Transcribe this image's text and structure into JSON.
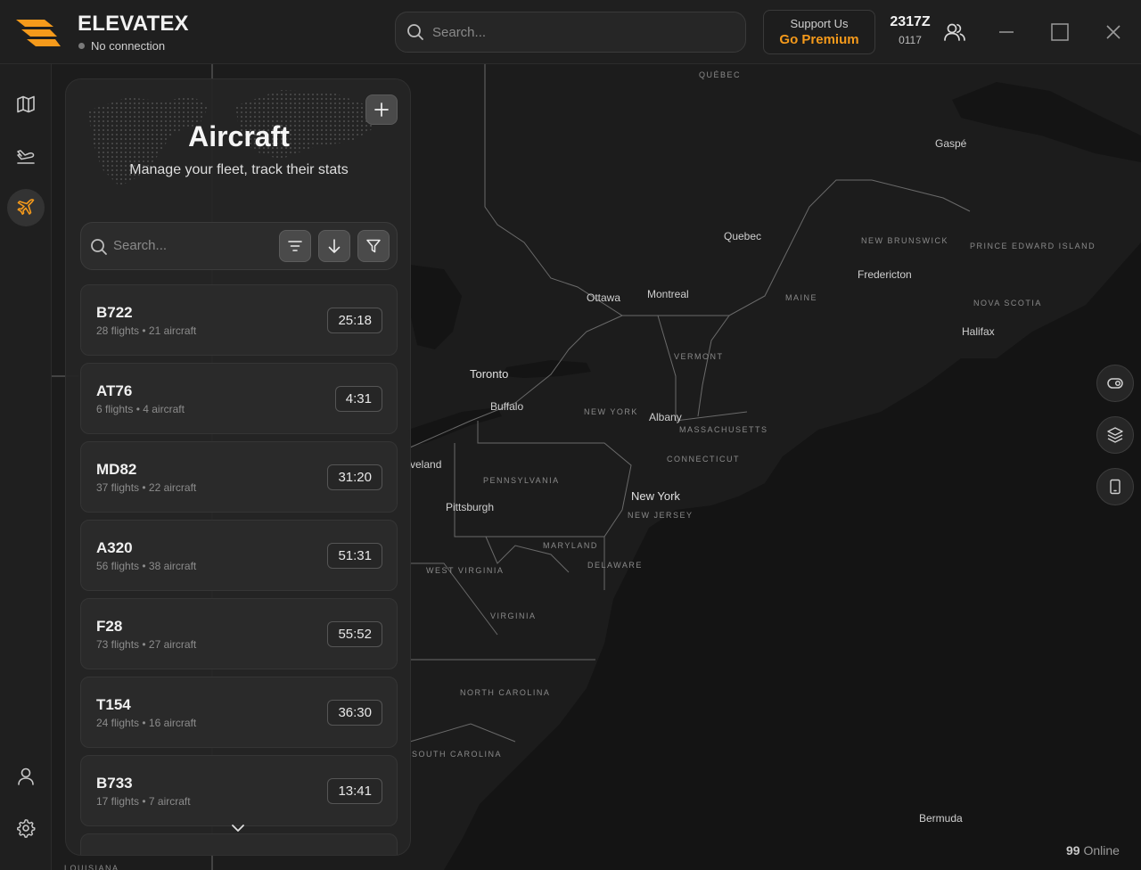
{
  "app": {
    "name": "ELEVATEX",
    "connection_status": "No connection",
    "search_placeholder": "Search...",
    "support_label": "Support Us",
    "premium_label": "Go Premium",
    "zulu_time": "2317Z",
    "local_time": "0117",
    "accent_color": "#f59a1b"
  },
  "rail": {
    "items": [
      {
        "name": "map-icon"
      },
      {
        "name": "flights-icon"
      },
      {
        "name": "aircraft-icon",
        "active": true
      },
      {
        "name": "profile-icon"
      },
      {
        "name": "settings-icon"
      }
    ]
  },
  "panel": {
    "title": "Aircraft",
    "subtitle": "Manage your fleet, track their stats",
    "search_placeholder": "Search...",
    "aircraft": [
      {
        "code": "B722",
        "meta": "28 flights • 21 aircraft",
        "time": "25:18"
      },
      {
        "code": "AT76",
        "meta": "6 flights • 4 aircraft",
        "time": "4:31"
      },
      {
        "code": "MD82",
        "meta": "37 flights • 22 aircraft",
        "time": "31:20"
      },
      {
        "code": "A320",
        "meta": "56 flights • 38 aircraft",
        "time": "51:31"
      },
      {
        "code": "F28",
        "meta": "73 flights • 27 aircraft",
        "time": "55:52"
      },
      {
        "code": "T154",
        "meta": "24 flights • 16 aircraft",
        "time": "36:30"
      },
      {
        "code": "B733",
        "meta": "17 flights • 7 aircraft",
        "time": "13:41"
      }
    ]
  },
  "map": {
    "labels": {
      "quebec_province": "QUÉBEC",
      "gaspe": "Gaspé",
      "quebec_city": "Quebec",
      "new_brunswick": "NEW BRUNSWICK",
      "pei": "PRINCE EDWARD ISLAND",
      "fredericton": "Fredericton",
      "ottawa": "Ottawa",
      "montreal": "Montreal",
      "maine": "MAINE",
      "nova_scotia": "NOVA SCOTIA",
      "halifax": "Halifax",
      "vermont": "VERMONT",
      "toronto": "Toronto",
      "buffalo": "Buffalo",
      "new_york_state": "NEW YORK",
      "albany": "Albany",
      "massachusetts": "MASSACHUSETTS",
      "connecticut": "CONNECTICUT",
      "cleveland": "veland",
      "pennsylvania": "PENNSYLVANIA",
      "new_york_city": "New York",
      "new_jersey": "NEW JERSEY",
      "pittsburgh": "Pittsburgh",
      "maryland": "MARYLAND",
      "delaware": "DELAWARE",
      "west_virginia": "WEST VIRGINIA",
      "virginia": "VIRGINIA",
      "north_carolina": "NORTH CAROLINA",
      "south_carolina": "SOUTH CAROLINA",
      "bermuda": "Bermuda",
      "louisiana": "LOUISIANA"
    },
    "online_count": "99",
    "online_label": "Online",
    "controls": [
      {
        "name": "visibility-toggle-icon"
      },
      {
        "name": "layers-icon"
      },
      {
        "name": "tablet-icon"
      }
    ]
  }
}
